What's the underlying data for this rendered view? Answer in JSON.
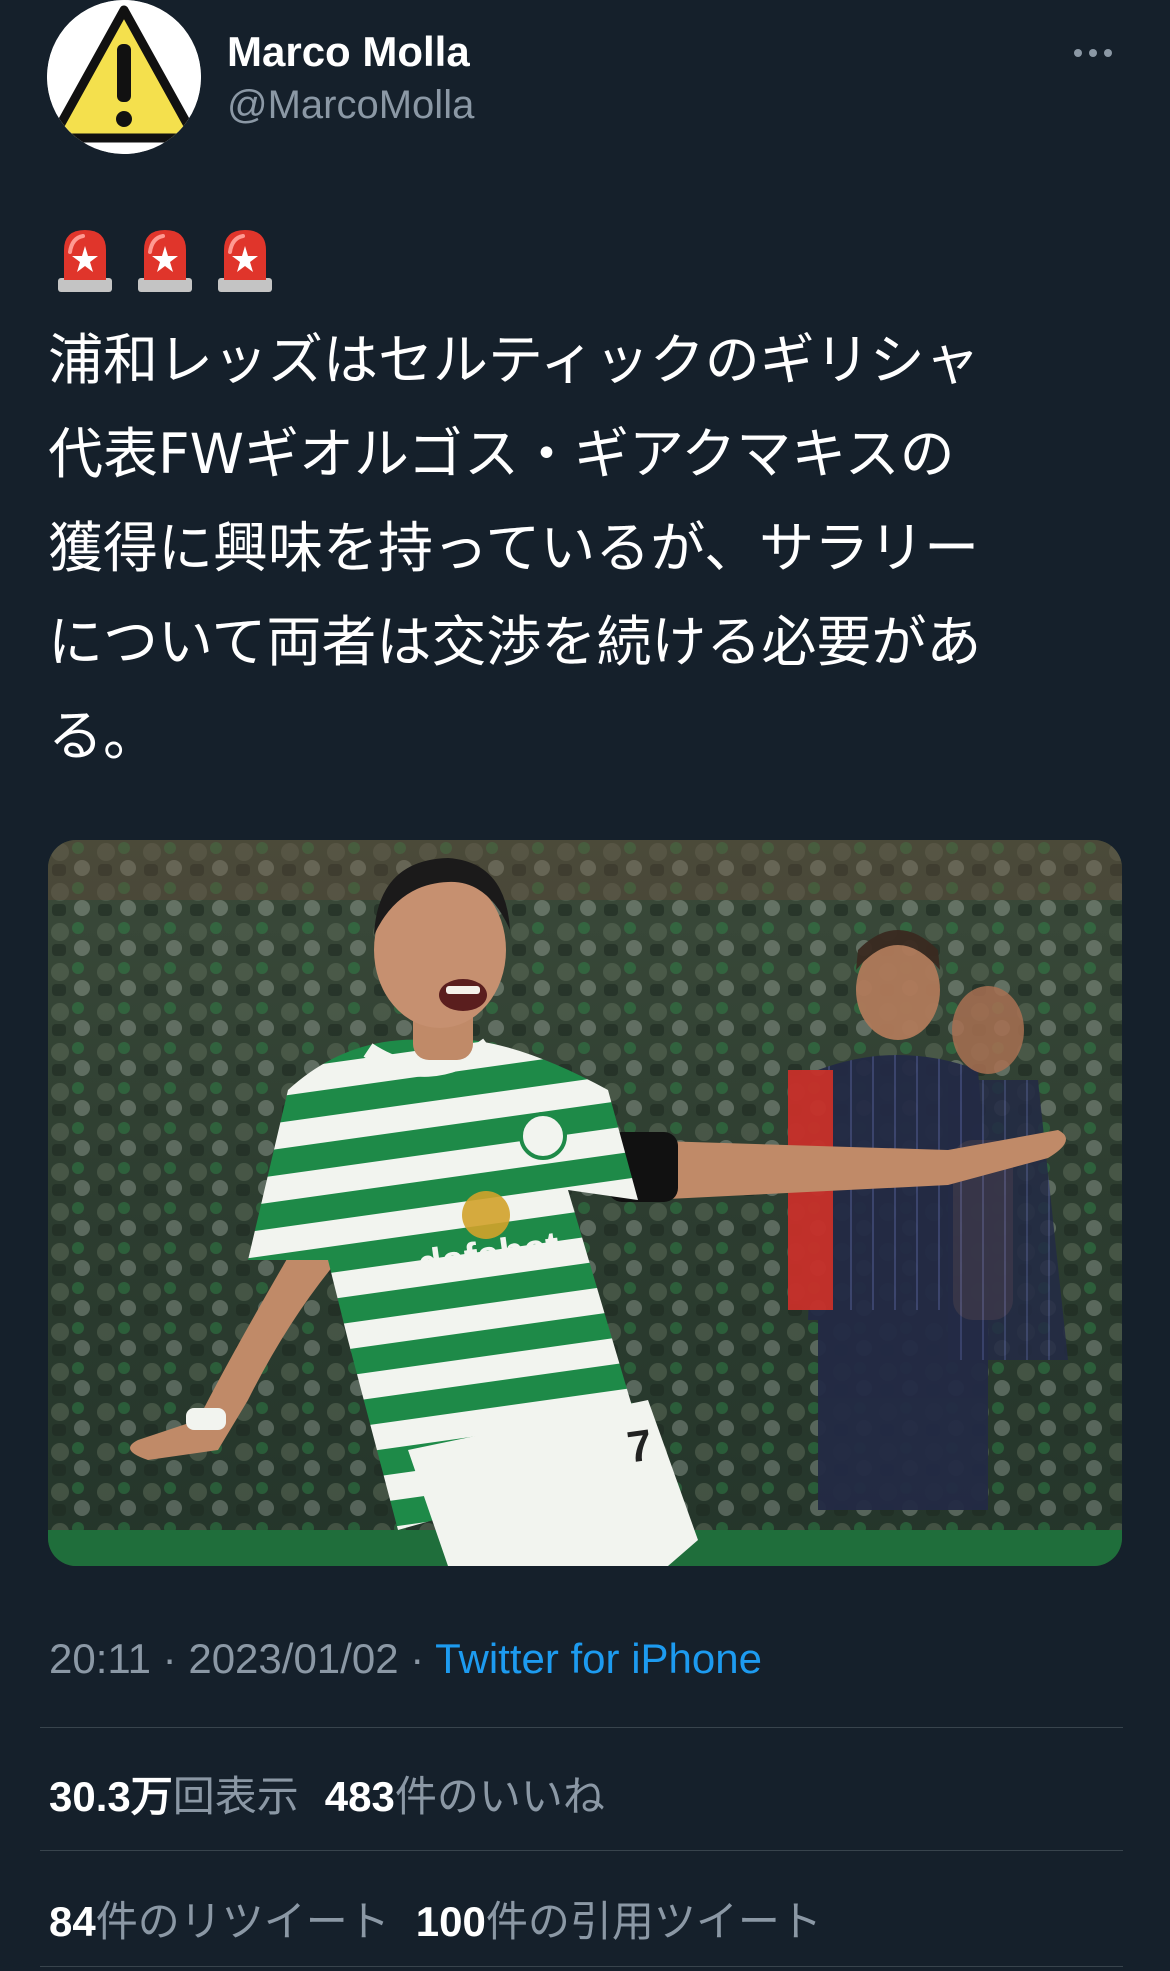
{
  "author": {
    "display_name": "Marco Molla",
    "handle": "@MarcoMolla",
    "avatar_icon": "warning-sign-icon"
  },
  "more_icon": "more-options-icon",
  "tweet": {
    "emojis": [
      "police-siren-emoji",
      "police-siren-emoji",
      "police-siren-emoji"
    ],
    "text": "浦和レッズはセルティックのギリシャ\n代表FWギオルゴス・ギアクマキスの\n獲得に興味を持っているが、サラリー\nについて両者は交渉を続ける必要があ\nる。"
  },
  "media": {
    "description_icon": "photo"
  },
  "meta": {
    "time": "20:11",
    "date": "2023/01/02",
    "separator": "·",
    "source": "Twitter for iPhone"
  },
  "stats": {
    "views_num": "30.3万",
    "views_label": "回表示",
    "likes_num": "483",
    "likes_label": "件のいいね",
    "retweets_num": "84",
    "retweets_label": "件のリツイート",
    "quotes_num": "100",
    "quotes_label": "件の引用ツイート"
  },
  "colors": {
    "background": "#15202b",
    "text": "#ffffff",
    "secondary": "#8b98a5",
    "link": "#1d9bf0",
    "divider": "#38444d"
  }
}
